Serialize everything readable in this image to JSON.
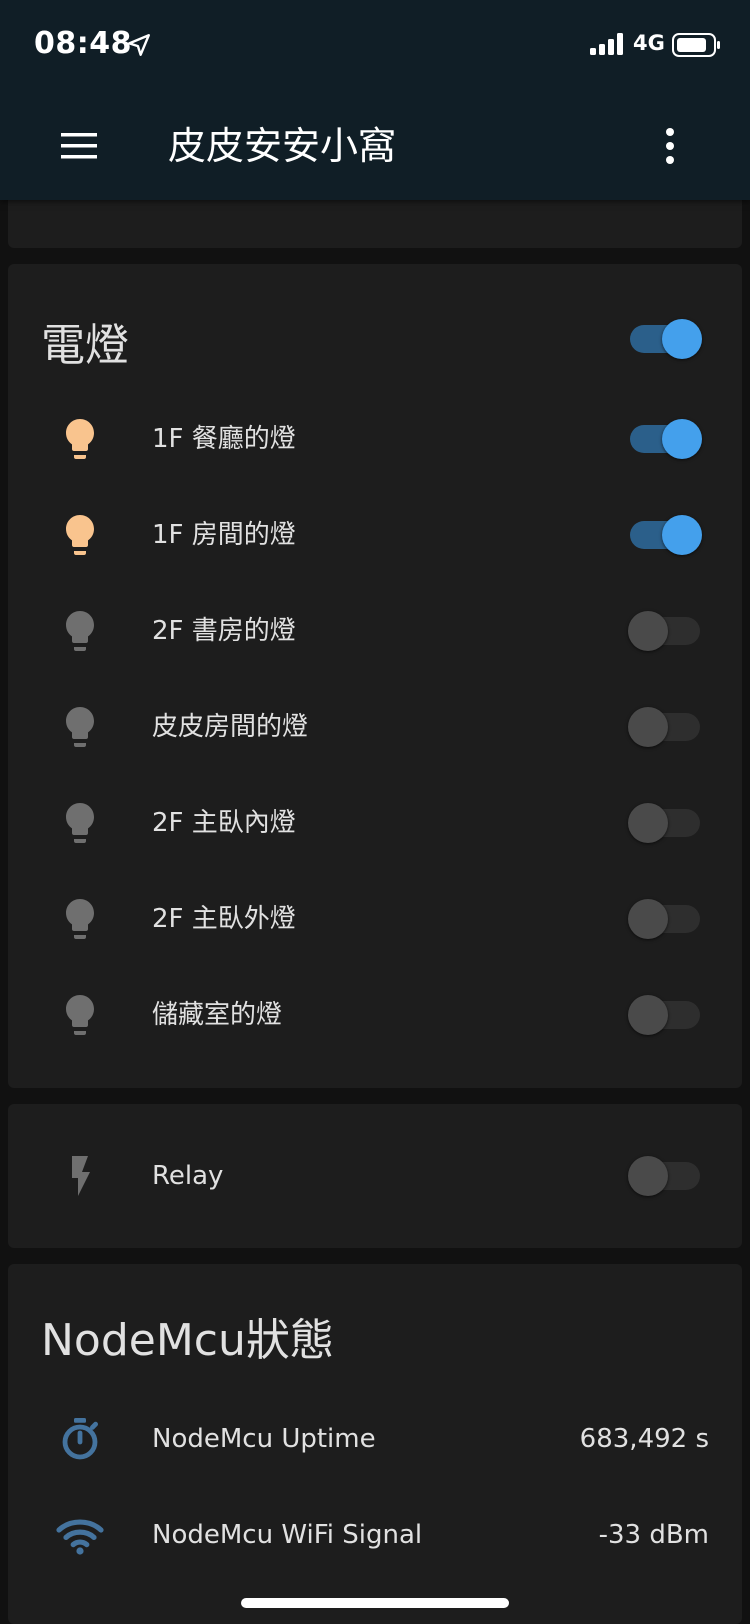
{
  "status_bar": {
    "time": "08:48",
    "network": "4G",
    "location_icon": "location-arrow-icon",
    "signal_icon": "cellular-signal-icon",
    "battery_icon": "battery-icon"
  },
  "app_bar": {
    "title": "皮皮安安小窩",
    "menu_icon": "hamburger-menu-icon",
    "more_icon": "more-vertical-icon",
    "background": "#101e26"
  },
  "lights_card": {
    "title": "電燈",
    "master_on": true,
    "items": [
      {
        "label": "1F 餐廳的燈",
        "on": true,
        "icon": "lightbulb-icon"
      },
      {
        "label": "1F 房間的燈",
        "on": true,
        "icon": "lightbulb-icon"
      },
      {
        "label": "2F 書房的燈",
        "on": false,
        "icon": "lightbulb-icon"
      },
      {
        "label": "皮皮房間的燈",
        "on": false,
        "icon": "lightbulb-icon"
      },
      {
        "label": "2F 主臥內燈",
        "on": false,
        "icon": "lightbulb-icon"
      },
      {
        "label": "2F 主臥外燈",
        "on": false,
        "icon": "lightbulb-icon"
      },
      {
        "label": "儲藏室的燈",
        "on": false,
        "icon": "lightbulb-icon"
      }
    ]
  },
  "relay_card": {
    "label": "Relay",
    "on": false,
    "icon": "flash-icon"
  },
  "status_card": {
    "title": "NodeMcu狀態",
    "items": [
      {
        "label": "NodeMcu Uptime",
        "value": "683,492 s",
        "icon": "timer-icon"
      },
      {
        "label": "NodeMcu WiFi Signal",
        "value": "-33 dBm",
        "icon": "wifi-icon"
      }
    ]
  },
  "colors": {
    "background": "#111111",
    "card": "#1d1d1d",
    "toggle_on": "#44a0ec",
    "toggle_on_track": "#2b5f8a",
    "bulb_on": "#f9c48e",
    "bulb_off": "#6f6f6f",
    "sensor_icon": "#44739e"
  }
}
